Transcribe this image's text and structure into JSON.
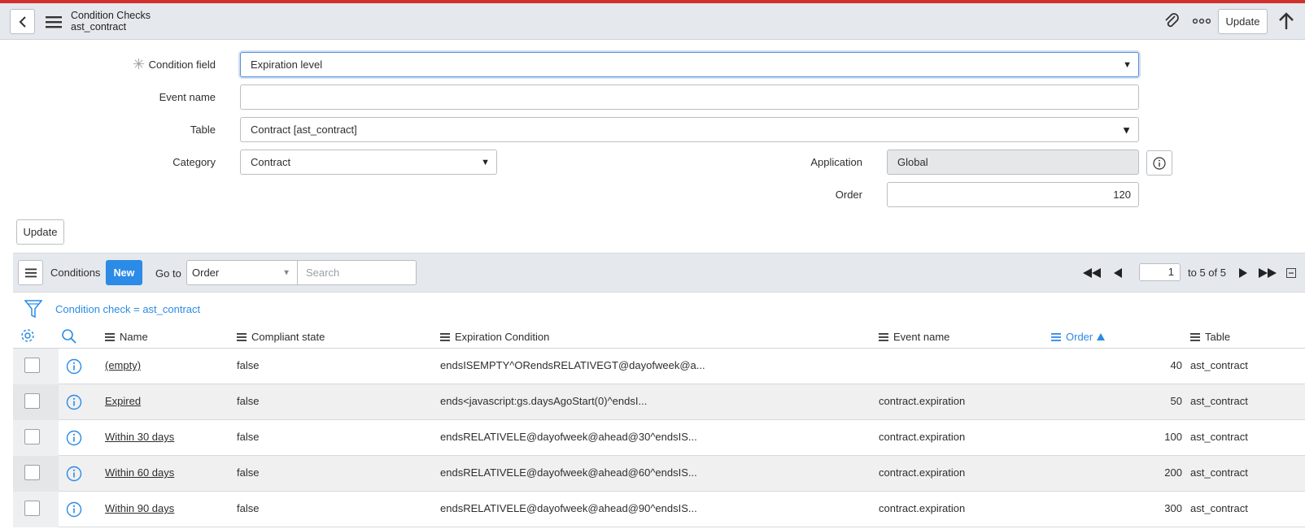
{
  "header": {
    "title": "Condition Checks",
    "subtitle": "ast_contract",
    "update_label": "Update"
  },
  "form": {
    "condition_field": {
      "label": "Condition field",
      "value": "Expiration level"
    },
    "event_name": {
      "label": "Event name",
      "value": ""
    },
    "table": {
      "label": "Table",
      "value": "Contract [ast_contract]"
    },
    "category": {
      "label": "Category",
      "value": "Contract"
    },
    "application": {
      "label": "Application",
      "value": "Global"
    },
    "order": {
      "label": "Order",
      "value": "120"
    },
    "update_label": "Update"
  },
  "list": {
    "title": "Conditions",
    "new_label": "New",
    "goto_label": "Go to",
    "goto_selected": "Order",
    "search_placeholder": "Search",
    "page": "1",
    "range": "to 5 of 5",
    "filter_text": "Condition check = ast_contract",
    "columns": [
      "Name",
      "Compliant state",
      "Expiration Condition",
      "Event name",
      "Order",
      "Table"
    ],
    "sort": {
      "column": "Order",
      "direction": "ascending"
    },
    "rows": [
      {
        "name": "(empty)",
        "state": "false",
        "condition": "endsISEMPTY^ORendsRELATIVEGT@dayofweek@a...",
        "event": "",
        "order": "40",
        "table": "ast_contract"
      },
      {
        "name": "Expired",
        "state": "false",
        "condition": "ends<javascript:gs.daysAgoStart(0)^endsI...",
        "event": "contract.expiration",
        "order": "50",
        "table": "ast_contract"
      },
      {
        "name": "Within 30 days",
        "state": "false",
        "condition": "endsRELATIVELE@dayofweek@ahead@30^endsIS...",
        "event": "contract.expiration",
        "order": "100",
        "table": "ast_contract"
      },
      {
        "name": "Within 60 days",
        "state": "false",
        "condition": "endsRELATIVELE@dayofweek@ahead@60^endsIS...",
        "event": "contract.expiration",
        "order": "200",
        "table": "ast_contract"
      },
      {
        "name": "Within 90 days",
        "state": "false",
        "condition": "endsRELATIVELE@dayofweek@ahead@90^endsIS...",
        "event": "contract.expiration",
        "order": "300",
        "table": "ast_contract"
      }
    ]
  },
  "colors": {
    "accent_bar": "#d0312d",
    "primary": "#2b8be6",
    "header_bg": "#e5e8ec"
  },
  "icons": [
    "chevron-left-icon",
    "hamburger-icon",
    "paperclip-icon",
    "more-icon",
    "arrow-up-icon",
    "info-icon",
    "first-page-icon",
    "prev-page-icon",
    "next-page-icon",
    "last-page-icon",
    "collapse-icon",
    "filter-icon",
    "gear-icon",
    "search-icon",
    "sort-asc-icon"
  ]
}
